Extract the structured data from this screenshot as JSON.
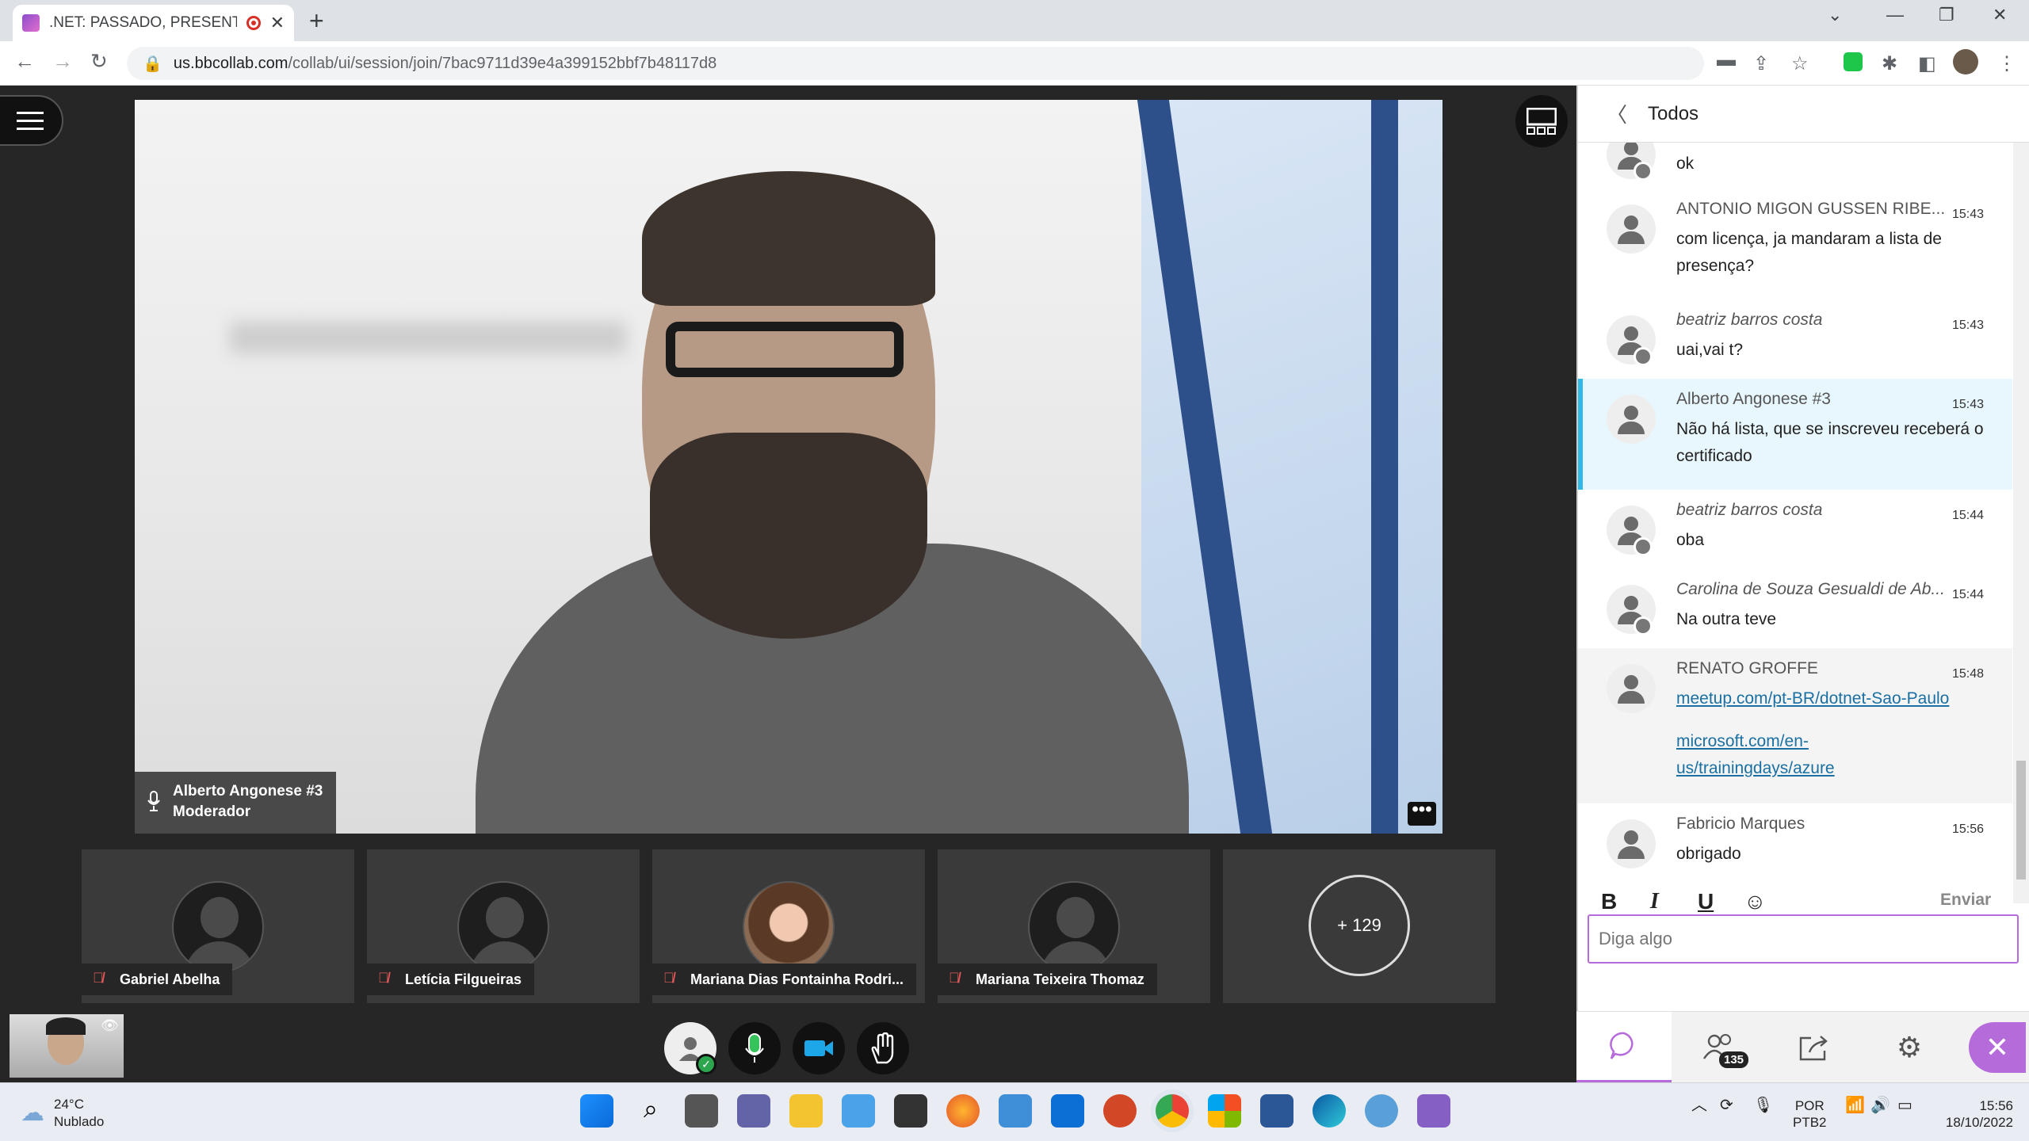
{
  "browser": {
    "tab_title": ".NET: PASSADO, PRESENTE, F",
    "tab_close": "✕",
    "new_tab": "+",
    "url_domain": "us.bbcollab.com",
    "url_path": "/collab/ui/session/join/7bac9711d39e4a399152bbf7b48117d8"
  },
  "session": {
    "speaker_name": "Alberto Angonese #3",
    "speaker_role": "Moderador",
    "more": "•••",
    "participants": [
      {
        "name": "Gabriel Abelha",
        "photo": false
      },
      {
        "name": "Letícia Filgueiras",
        "photo": false
      },
      {
        "name": "Mariana Dias Fontainha Rodri...",
        "photo": true
      },
      {
        "name": "Mariana Teixeira Thomaz",
        "photo": false
      }
    ],
    "more_participants": "+ 129"
  },
  "chat": {
    "header": "Todos",
    "messages": [
      {
        "author": "",
        "time": "",
        "text": "ok",
        "italic": false,
        "badge": true,
        "style": ""
      },
      {
        "author": "ANTONIO MIGON GUSSEN RIBE...",
        "time": "15:43",
        "text": "com licença, ja mandaram a lista de presença?",
        "italic": false,
        "badge": false,
        "style": ""
      },
      {
        "author": "beatriz barros costa",
        "time": "15:43",
        "text": "uai,vai t?",
        "italic": true,
        "badge": true,
        "style": ""
      },
      {
        "author": "Alberto Angonese #3",
        "time": "15:43",
        "text": "Não há lista, que se inscreveu receberá o certificado",
        "italic": false,
        "badge": false,
        "style": "hl"
      },
      {
        "author": "beatriz barros costa",
        "time": "15:44",
        "text": "oba",
        "italic": true,
        "badge": true,
        "style": ""
      },
      {
        "author": "Carolina de Souza Gesualdi de Ab...",
        "time": "15:44",
        "text": "Na outra teve",
        "italic": true,
        "badge": true,
        "style": ""
      },
      {
        "author": "RENATO GROFFE",
        "time": "15:48",
        "links": [
          "meetup.com/pt-BR/dotnet-Sao-Paulo",
          "microsoft.com/en-us/trainingdays/azure"
        ],
        "italic": false,
        "badge": false,
        "style": "grey"
      },
      {
        "author": "Fabricio Marques",
        "time": "15:56",
        "text": "obrigado",
        "italic": false,
        "badge": false,
        "style": ""
      }
    ],
    "input_placeholder": "Diga algo",
    "send_label": "Enviar",
    "format": {
      "bold": "B",
      "italic": "I",
      "underline": "U",
      "emoji": "☺"
    },
    "attendee_count": "135",
    "close": "✕"
  },
  "taskbar": {
    "temperature": "24°C",
    "condition": "Nublado",
    "lang": "POR",
    "layout": "PTB2",
    "time": "15:56",
    "date": "18/10/2022"
  }
}
